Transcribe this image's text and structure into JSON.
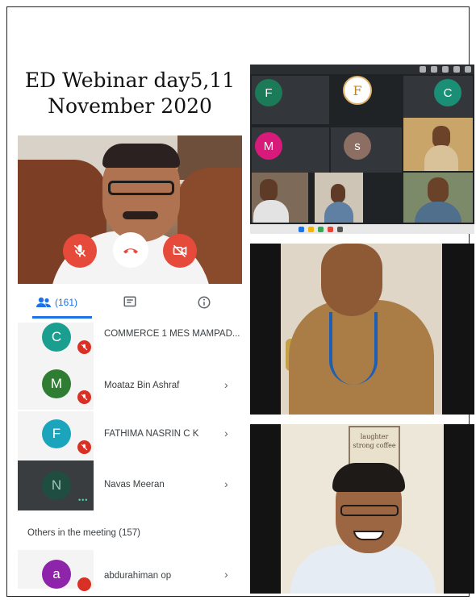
{
  "title": {
    "line1": "ED Webinar day5,11",
    "line2": "November 2020"
  },
  "call_controls": {
    "mic_icon": "mic-off-icon",
    "end_icon": "call-end-icon",
    "camera_icon": "camera-off-icon",
    "colors": {
      "danger": "#e64a3b",
      "end_bg": "#ffffff"
    }
  },
  "tabs": {
    "people_count": "(161)",
    "chat_icon": "chat-icon",
    "info_icon": "info-icon",
    "accent": "#1a73e8"
  },
  "participants": [
    {
      "initial": "C",
      "name": "COMMERCE 1 MES MAMPAD...",
      "color": "#1a9e8f",
      "muted": true
    },
    {
      "initial": "M",
      "name": "Moataz Bin Ashraf",
      "color": "#2e7d32",
      "muted": true
    },
    {
      "initial": "F",
      "name": "FATHIMA NASRIN C K",
      "color": "#1ba5bd",
      "muted": true
    },
    {
      "initial": "N",
      "name": "Navas Meeran",
      "color": "#1f4d40",
      "muted": false
    }
  ],
  "others": {
    "label": "Others in the meeting (157)",
    "first": {
      "initial": "a",
      "name": "abdurahiman op",
      "color": "#8e24aa"
    }
  },
  "meet_grid": {
    "tiles": [
      {
        "initial": "F",
        "color": "#1b7a57"
      },
      {
        "initial": "C",
        "color": "#1a8f75"
      },
      {
        "initial": "M",
        "color": "#d81b7a"
      },
      {
        "initial": "s",
        "color": "#8d6e63"
      }
    ],
    "logo_letter": "F"
  },
  "video_tiles": {
    "poster_text": "laughter strong coffee"
  }
}
